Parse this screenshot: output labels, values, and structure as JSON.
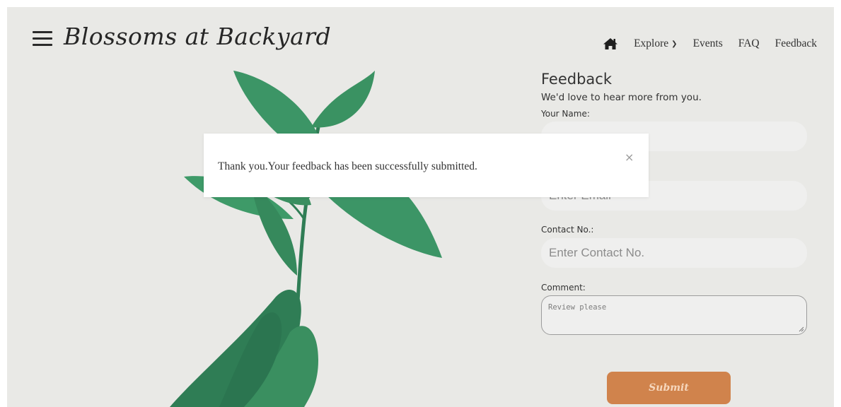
{
  "header": {
    "brand": "Blossoms at Backyard",
    "nav": {
      "explore": "Explore",
      "events": "Events",
      "faq": "FAQ",
      "feedback": "Feedback"
    }
  },
  "form": {
    "title": "Feedback",
    "subtitle": "We'd love to hear more from you.",
    "name_label": "Your Name:",
    "email_placeholder": "Enter Email",
    "contact_label": "Contact No.:",
    "contact_placeholder": "Enter Contact No.",
    "comment_label": "Comment:",
    "comment_value": "Review please",
    "submit_label": "Submit"
  },
  "modal": {
    "message": "Thank you.Your feedback has been successfully submitted.",
    "close_glyph": "×"
  },
  "colors": {
    "background": "#e9e9e6",
    "leaf": "#3c9566",
    "submit": "#d0834c",
    "modal": "#ffffff"
  }
}
